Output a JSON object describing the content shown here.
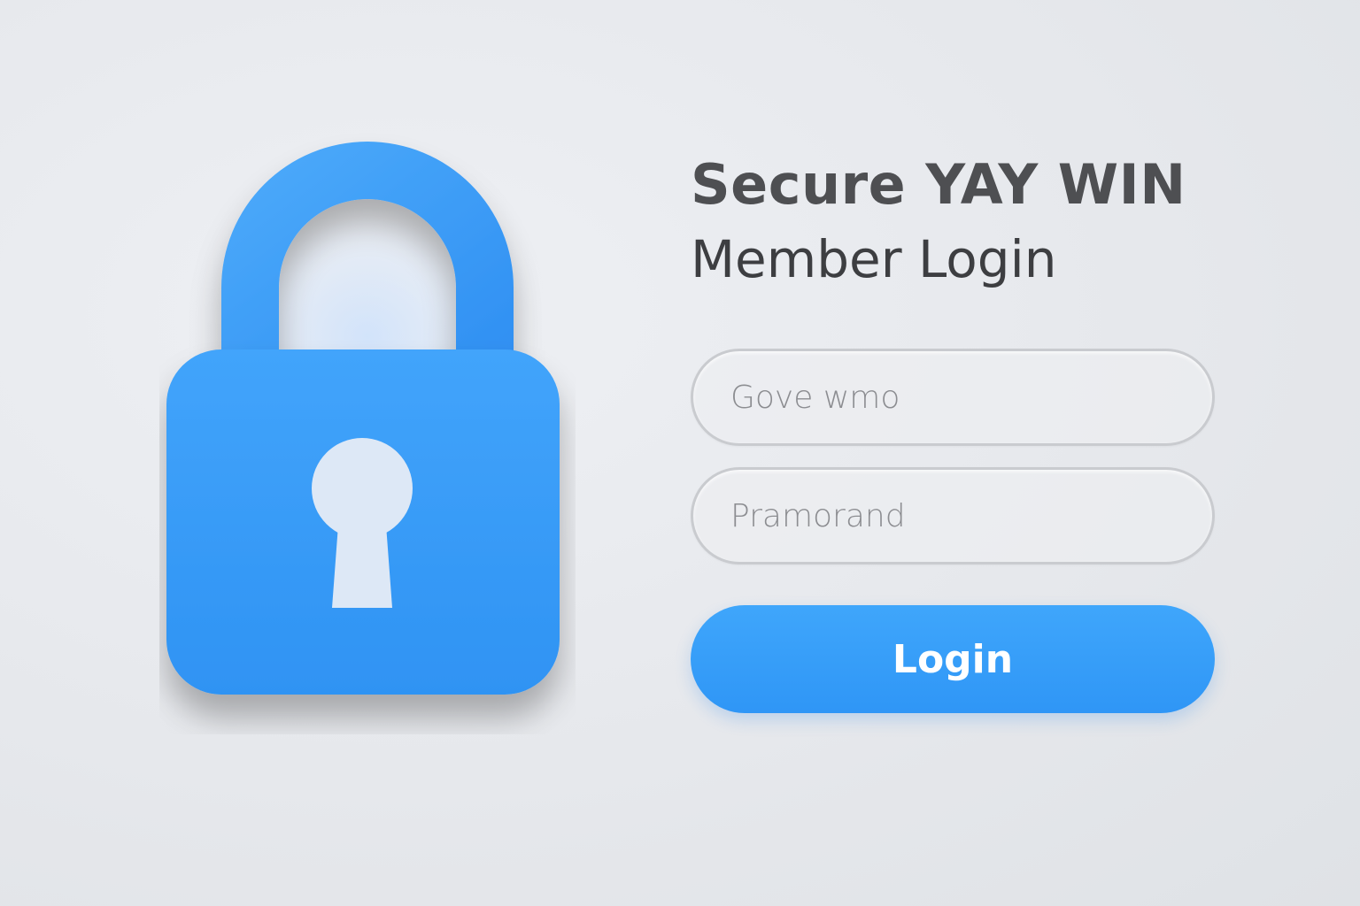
{
  "brand": {
    "title": "Secure YAY WIN",
    "subtitle": "Member Login"
  },
  "form": {
    "username_placeholder": "Gove wmo",
    "password_placeholder": "Pramorand",
    "login_label": "Login"
  },
  "icons": {
    "hero": "padlock-icon",
    "keyhole": "keyhole-icon"
  },
  "colors": {
    "accent": "#2f96f6",
    "lock_body": "#3a9ff8",
    "background": "#e6e8ec",
    "title_text": "#4e4f52",
    "field_border": "#c9cbcf"
  }
}
